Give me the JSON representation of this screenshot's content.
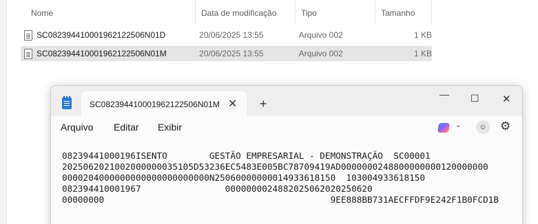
{
  "explorer": {
    "columns": {
      "name": "Nome",
      "date": "Data de modificação",
      "type": "Tipo",
      "size": "Tamanho"
    },
    "files": [
      {
        "name": "SC08239441000196212250​6N01D",
        "date": "20/06/2025 13:55",
        "type": "Arquivo 002",
        "size": "1 KB"
      },
      {
        "name": "SC082394410001962122506N01M",
        "date": "20/06/2025 13:55",
        "type": "Arquivo 002",
        "size": "1 KB"
      }
    ]
  },
  "notepad": {
    "tab_title": "SC082394410001962122506N01M.(",
    "menu": {
      "file": "Arquivo",
      "edit": "Editar",
      "view": "Exibir"
    },
    "content": "08239441000196ISENTO        GESTÃO EMPRESARIAL - DEMONSTRAÇÃO  SC00001\n2025062021002000000035105D53236EC5483E005BC78709419AD0000000248800000000120000000\n0000204000000000000000000000N250600000000149336181​50  103004933618150\n082394410001967                0000000024882025062020250620\n00000000                                           9EE888BB731AECFFDF9E242F1B0FCD1B"
  }
}
